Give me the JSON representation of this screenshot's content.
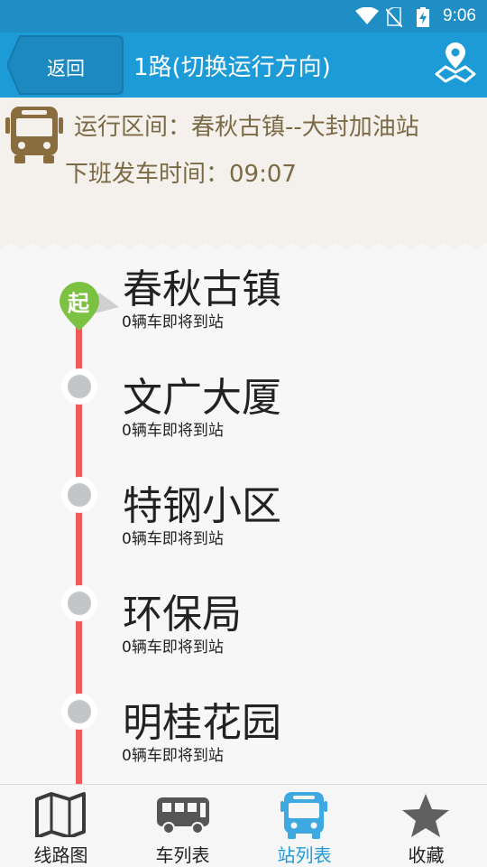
{
  "status_bar": {
    "time": "9:06"
  },
  "header": {
    "back_label": "返回",
    "title": "1路(切换运行方向)"
  },
  "info": {
    "route_range": "运行区间：春秋古镇--大封加油站",
    "last_bus": "下班发车时间：09:07"
  },
  "stops": [
    {
      "name": "春秋古镇",
      "status": "0辆车即将到站",
      "marker": "起"
    },
    {
      "name": "文广大厦",
      "status": "0辆车即将到站"
    },
    {
      "name": "特钢小区",
      "status": "0辆车即将到站"
    },
    {
      "name": "环保局",
      "status": "0辆车即将到站"
    },
    {
      "name": "明桂花园",
      "status": "0辆车即将到站"
    }
  ],
  "tabs": [
    {
      "label": "线路图",
      "icon": "map-icon"
    },
    {
      "label": "车列表",
      "icon": "bus-list-icon"
    },
    {
      "label": "站列表",
      "icon": "station-list-icon",
      "active": true
    },
    {
      "label": "收藏",
      "icon": "star-icon"
    }
  ],
  "colors": {
    "header_bg": "#1d9bd6",
    "route_line": "#f05a5a",
    "start_marker": "#7cc242",
    "info_text": "#7b6a45",
    "active_tab": "#1d9bd6"
  }
}
